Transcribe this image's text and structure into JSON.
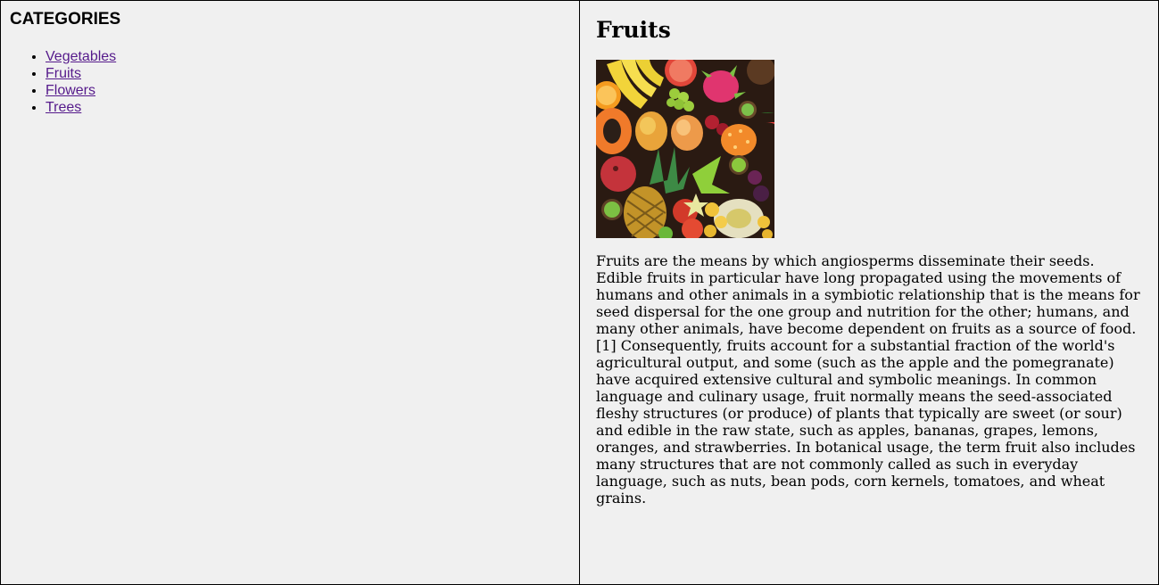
{
  "sidebar": {
    "title": "CATEGORIES",
    "items": [
      {
        "label": "Vegetables"
      },
      {
        "label": "Fruits"
      },
      {
        "label": "Flowers"
      },
      {
        "label": "Trees"
      }
    ]
  },
  "main": {
    "title": "Fruits",
    "image_icon": "fruit-assortment-image",
    "description": "Fruits are the means by which angiosperms disseminate their seeds. Edible fruits in particular have long propagated using the movements of humans and other animals in a symbiotic relationship that is the means for seed dispersal for the one group and nutrition for the other; humans, and many other animals, have become dependent on fruits as a source of food.[1] Consequently, fruits account for a substantial fraction of the world's agricultural output, and some (such as the apple and the pomegranate) have acquired extensive cultural and symbolic meanings. In common language and culinary usage, fruit normally means the seed-associated fleshy structures (or produce) of plants that typically are sweet (or sour) and edible in the raw state, such as apples, bananas, grapes, lemons, oranges, and strawberries. In botanical usage, the term fruit also includes many structures that are not commonly called as such in everyday language, such as nuts, bean pods, corn kernels, tomatoes, and wheat grains."
  },
  "colors": {
    "background": "#f0f0f0",
    "link_visited": "#551a8b",
    "border": "#000000"
  }
}
